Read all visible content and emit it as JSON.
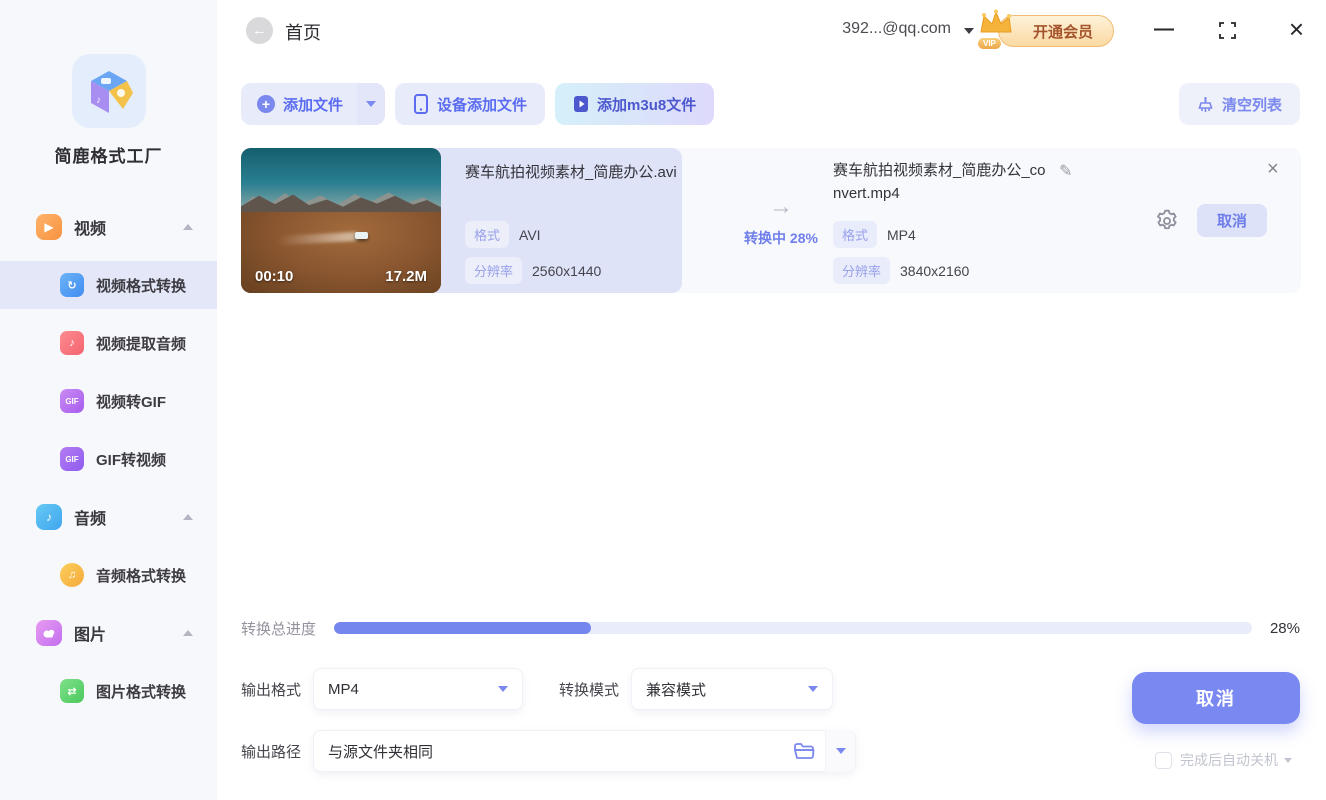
{
  "app": {
    "name": "简鹿格式工厂"
  },
  "topbar": {
    "back_label": "首页",
    "account": "392...@qq.com",
    "vip": {
      "label": "开通会员",
      "tag": "VIP"
    }
  },
  "toolbar": {
    "add_file": "添加文件",
    "device_add": "设备添加文件",
    "add_m3u8": "添加m3u8文件",
    "clear_list": "清空列表"
  },
  "sidebar": {
    "groups": [
      {
        "label": "视频",
        "icon": "video-camera-icon",
        "items": [
          {
            "label": "视频格式转换",
            "icon": "video-convert-icon",
            "active": true
          },
          {
            "label": "视频提取音频",
            "icon": "extract-audio-icon",
            "active": false
          },
          {
            "label": "视频转GIF",
            "icon": "video-to-gif-icon",
            "active": false
          },
          {
            "label": "GIF转视频",
            "icon": "gif-to-video-icon",
            "active": false
          }
        ]
      },
      {
        "label": "音频",
        "icon": "audio-icon",
        "items": [
          {
            "label": "音频格式转换",
            "icon": "audio-convert-icon",
            "active": false
          }
        ]
      },
      {
        "label": "图片",
        "icon": "image-icon",
        "items": [
          {
            "label": "图片格式转换",
            "icon": "image-convert-icon",
            "active": false
          }
        ]
      }
    ]
  },
  "task": {
    "duration": "00:10",
    "size": "17.2M",
    "source": {
      "filename": "赛车航拍视频素材_简鹿办公.avi",
      "format_label": "格式",
      "format": "AVI",
      "resolution_label": "分辨率",
      "resolution": "2560x1440"
    },
    "status": "转换中 28%",
    "target": {
      "filename": "赛车航拍视频素材_简鹿办公_convert.mp4",
      "format_label": "格式",
      "format": "MP4",
      "resolution_label": "分辨率",
      "resolution": "3840x2160"
    },
    "cancel_label": "取消"
  },
  "footer": {
    "progress_label": "转换总进度",
    "progress_percent": 28,
    "progress_text": "28%",
    "output_format": {
      "label": "输出格式",
      "value": "MP4"
    },
    "convert_mode": {
      "label": "转换模式",
      "value": "兼容模式"
    },
    "output_path": {
      "label": "输出路径",
      "value": "与源文件夹相同"
    },
    "cancel_label": "取消",
    "shutdown_label": "完成后自动关机"
  },
  "icons": {
    "back": "←",
    "plus": "+",
    "arrow_right": "→",
    "edit": "✎",
    "close": "×",
    "minimize": "—",
    "video_glyph": "▶",
    "video_convert_glyph": "↻",
    "note_glyph": "♪",
    "notes_glyph": "♫",
    "gif_glyph": "GIF",
    "swap_glyph": "⇄"
  },
  "colors": {
    "accent": "#7b88ee",
    "accent_deep": "#5b6cf0",
    "sidebar_bg": "#f7f8fb",
    "active_item_bg": "#e4e7f8",
    "row_bg": "#f8f9fd",
    "source_panel_bg": "#dfe3f7",
    "progress_fill": "#7586ef",
    "big_button_bg": "#7a89f2",
    "vip_text": "#a4542c"
  }
}
